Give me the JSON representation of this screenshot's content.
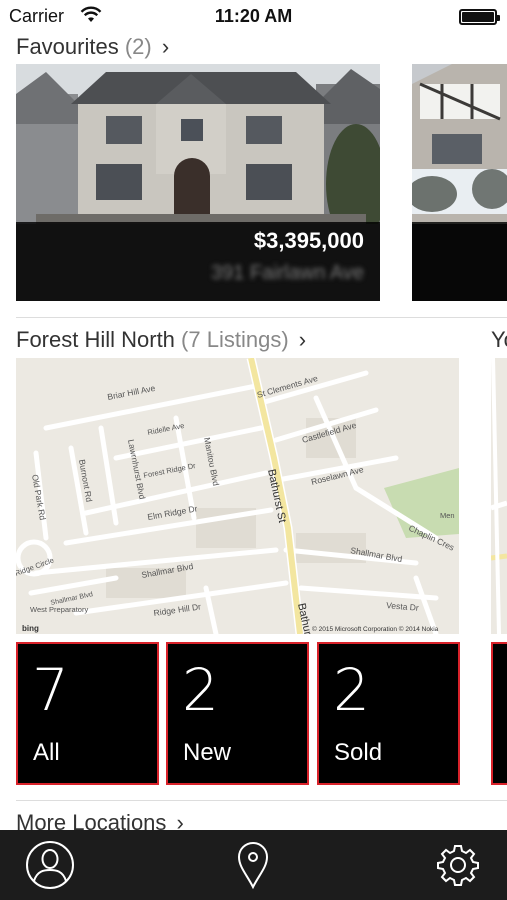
{
  "status_bar": {
    "carrier": "Carrier",
    "time": "11:20 AM",
    "icons": [
      "wifi-icon",
      "battery-icon"
    ]
  },
  "favourites": {
    "title": "Favourites",
    "count": "(2)",
    "cards": [
      {
        "price": "$3,395,000",
        "address": "391 Fairlawn Ave"
      }
    ]
  },
  "neighbourhood": {
    "title": "Forest Hill North",
    "count": "(7 Listings)",
    "peek_title": "Yo",
    "map": {
      "streets": [
        "St Clements Ave",
        "Briar Hill Ave",
        "Ridelle Ave",
        "Castlefield Ave",
        "Lawrnhurst Blvd",
        "Manitou Blvd",
        "Forest Ridge Dr",
        "Roselawn Ave",
        "Bathurst St",
        "Burnont Rd",
        "Old Park Rd",
        "Elm Ridge Dr",
        "Chaplin Cres",
        "Shallmar Blvd",
        "Ridge Circle",
        "Ridge Hill Dr",
        "Vesta Dr",
        "West Preparatory",
        "Men",
        "Bathurst"
      ],
      "copyright": "© 2015 Microsoft Corporation © 2014 Nokia",
      "provider": "bing"
    },
    "stats": [
      {
        "value": "7",
        "label": "All"
      },
      {
        "value": "2",
        "label": "New"
      },
      {
        "value": "2",
        "label": "Sold"
      }
    ]
  },
  "more_locations": {
    "label": "More Locations"
  },
  "tabbar": {
    "items": [
      "profile-icon",
      "location-pin-icon",
      "settings-gear-icon"
    ]
  },
  "colors": {
    "tile_border": "#d9222a",
    "tabbar_bg": "#1c1c1c",
    "map_bg": "#ece9e2"
  }
}
